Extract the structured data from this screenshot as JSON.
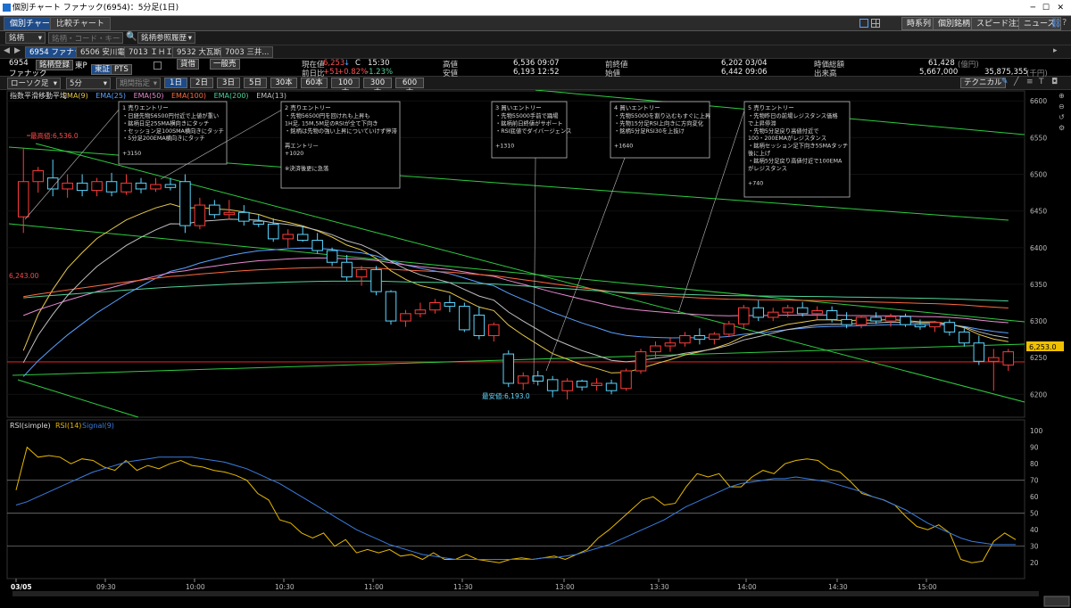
{
  "window": {
    "title": "個別チャート ファナック(6954)：5分足(1日)"
  },
  "tabs": [
    {
      "label": "個別チャート"
    },
    {
      "label": "比較チャート"
    }
  ],
  "top_buttons": [
    "時系列",
    "個別銘柄",
    "スピード注文",
    "ニュース"
  ],
  "symbol_bar": {
    "type": "銘柄",
    "search_placeholder": "銘柄・コード・キーワード",
    "history": "銘柄参照履歴"
  },
  "symbol_tabs": [
    "6954 ファナック",
    "6506 安川電",
    "7013 ＩＨＩ",
    "9532 大瓦斯",
    "7003 三井..."
  ],
  "quote": {
    "code": "6954",
    "name": "ファナック",
    "register": "銘柄登録",
    "market": "東P",
    "exch_tse": "東証",
    "exch_pts": "PTS",
    "order_type": "貸借",
    "margin": "一般売",
    "current_label": "現在値",
    "current": "6,253",
    "arrow": "↓",
    "c": "C",
    "time": "15:30",
    "prev_diff_label": "前日比",
    "diff": "+51",
    "diff_pct": "+0.82%",
    "diff_pct2": "-1.23%",
    "high_label": "高値",
    "high": "6,536 09:07",
    "low_label": "安値",
    "low": "6,193 12:52",
    "prev_close_label": "前終値",
    "prev_close": "6,202 03/04",
    "open_label": "始値",
    "open": "6,442 09:06",
    "mcap_label": "時価総額",
    "mcap": "61,428",
    "mcap_unit": "(億円)",
    "volume_label": "出来高",
    "volume": "5,667,000",
    "turnover": "35,875,355",
    "turnover_unit": "(千円)"
  },
  "controls": {
    "chart_type": "ローソク足",
    "interval": "5分",
    "period": "期間指定",
    "ranges": [
      "1日",
      "2日",
      "3日",
      "5日",
      "30本",
      "60本",
      "100本",
      "300本",
      "600本"
    ],
    "technical": "テクニカル"
  },
  "legend": {
    "title": "指数平滑移動平均",
    "items": [
      {
        "label": "EMA(9)",
        "color": "#e6c84a"
      },
      {
        "label": "EMA(25)",
        "color": "#5aa0ff"
      },
      {
        "label": "EMA(50)",
        "color": "#e68ad0"
      },
      {
        "label": "EMA(100)",
        "color": "#ff6a3d"
      },
      {
        "label": "EMA(200)",
        "color": "#4fd29a"
      },
      {
        "label": "EMA(13)",
        "color": "#c0c0c0"
      }
    ]
  },
  "annotations": [
    {
      "title": "1 売りエントリー",
      "lines": [
        "・日経先物56500円付近で上値が重い",
        "・銘柄日足25SMA横向きにタッチ",
        "・セッション足100SMA横向きにタッチ",
        "・5分足200EMA横向きにタッチ",
        "",
        "+3150"
      ]
    },
    {
      "title": "2 売りエントリー",
      "lines": [
        "・先物56500円を回けれも上昇も",
        "1H足, 15M,5M足のRSIが全て下向き",
        "・銘柄は先物の強い上昇についていけず停滞",
        "",
        "再エントリー",
        "+1020",
        "",
        "※決済後更に急落"
      ]
    },
    {
      "title": "3 買いエントリー",
      "lines": [
        "・先物55000手前で踊場",
        "・銘柄前日終値がサポート",
        "・RSI底値でダイバージェンス",
        "",
        "+1310"
      ]
    },
    {
      "title": "4 買いエントリー",
      "lines": [
        "・先物55000を割り込むもすぐに上昇",
        "・先物15分足RSI上向きに方向変化",
        "・銘柄5分足RSI30を上抜け",
        "",
        "+1640"
      ]
    },
    {
      "title": "5 売りエントリー",
      "lines": [
        "・先物昨日の前場レジスタンス価格",
        "で上昇停滞",
        "・先物5分足戻り高値付近で",
        "100・200EMAがレジスタンス",
        "・銘柄セッション足下向き5SMAタッチ",
        "後に上げ",
        "・銘柄5分足戻り高値付近で100EMA",
        "がレジスタンス",
        "",
        "+740"
      ]
    }
  ],
  "markers": {
    "high_label": "最高値:6,536.0",
    "low_label": "最安値:6,193.0",
    "level_label": "6,243.00",
    "last_price": "6,253.0"
  },
  "chart_data": [
    {
      "type": "candlestick",
      "title": "指数平滑移動平均",
      "ylim": [
        6170,
        6610
      ],
      "yticks": [
        6200,
        6250,
        6300,
        6350,
        6400,
        6450,
        6500,
        6550,
        6600
      ],
      "xticks": [
        "03/05",
        "09:30",
        "10:00",
        "10:30",
        "11:00",
        "11:30",
        "13:00",
        "13:30",
        "14:00",
        "14:30",
        "15:00"
      ],
      "candles": [
        {
          "t": "09:00",
          "o": 6442,
          "h": 6536,
          "l": 6420,
          "c": 6490
        },
        {
          "t": "09:05",
          "o": 6490,
          "h": 6510,
          "l": 6475,
          "c": 6505
        },
        {
          "t": "09:10",
          "o": 6495,
          "h": 6520,
          "l": 6470,
          "c": 6480
        },
        {
          "t": "09:15",
          "o": 6480,
          "h": 6500,
          "l": 6468,
          "c": 6488
        },
        {
          "t": "09:20",
          "o": 6488,
          "h": 6500,
          "l": 6470,
          "c": 6478
        },
        {
          "t": "09:25",
          "o": 6478,
          "h": 6495,
          "l": 6470,
          "c": 6490
        },
        {
          "t": "09:30",
          "o": 6490,
          "h": 6502,
          "l": 6470,
          "c": 6476
        },
        {
          "t": "09:35",
          "o": 6476,
          "h": 6500,
          "l": 6472,
          "c": 6488
        },
        {
          "t": "09:40",
          "o": 6488,
          "h": 6495,
          "l": 6474,
          "c": 6480
        },
        {
          "t": "09:45",
          "o": 6480,
          "h": 6495,
          "l": 6476,
          "c": 6486
        },
        {
          "t": "09:50",
          "o": 6486,
          "h": 6495,
          "l": 6478,
          "c": 6482
        },
        {
          "t": "09:55",
          "o": 6490,
          "h": 6500,
          "l": 6420,
          "c": 6430
        },
        {
          "t": "10:00",
          "o": 6430,
          "h": 6468,
          "l": 6425,
          "c": 6458
        },
        {
          "t": "10:05",
          "o": 6458,
          "h": 6465,
          "l": 6440,
          "c": 6445
        },
        {
          "t": "10:10",
          "o": 6445,
          "h": 6465,
          "l": 6438,
          "c": 6448
        },
        {
          "t": "10:15",
          "o": 6448,
          "h": 6458,
          "l": 6430,
          "c": 6436
        },
        {
          "t": "10:20",
          "o": 6436,
          "h": 6445,
          "l": 6428,
          "c": 6432
        },
        {
          "t": "10:25",
          "o": 6432,
          "h": 6440,
          "l": 6408,
          "c": 6412
        },
        {
          "t": "10:30",
          "o": 6412,
          "h": 6425,
          "l": 6400,
          "c": 6418
        },
        {
          "t": "10:35",
          "o": 6418,
          "h": 6430,
          "l": 6408,
          "c": 6410
        },
        {
          "t": "10:40",
          "o": 6410,
          "h": 6420,
          "l": 6392,
          "c": 6396
        },
        {
          "t": "10:45",
          "o": 6396,
          "h": 6400,
          "l": 6375,
          "c": 6380
        },
        {
          "t": "10:50",
          "o": 6380,
          "h": 6390,
          "l": 6355,
          "c": 6360
        },
        {
          "t": "10:55",
          "o": 6360,
          "h": 6375,
          "l": 6348,
          "c": 6370
        },
        {
          "t": "11:00",
          "o": 6370,
          "h": 6375,
          "l": 6335,
          "c": 6340
        },
        {
          "t": "11:05",
          "o": 6340,
          "h": 6342,
          "l": 6295,
          "c": 6300
        },
        {
          "t": "11:10",
          "o": 6300,
          "h": 6315,
          "l": 6292,
          "c": 6310
        },
        {
          "t": "11:15",
          "o": 6310,
          "h": 6325,
          "l": 6305,
          "c": 6315
        },
        {
          "t": "11:20",
          "o": 6315,
          "h": 6330,
          "l": 6310,
          "c": 6325
        },
        {
          "t": "11:25",
          "o": 6325,
          "h": 6335,
          "l": 6312,
          "c": 6320
        },
        {
          "t": "11:30",
          "o": 6320,
          "h": 6325,
          "l": 6285,
          "c": 6288
        },
        {
          "t": "12:30",
          "o": 6308,
          "h": 6320,
          "l": 6275,
          "c": 6280
        },
        {
          "t": "12:35",
          "o": 6280,
          "h": 6298,
          "l": 6272,
          "c": 6295
        },
        {
          "t": "12:40",
          "o": 6255,
          "h": 6260,
          "l": 6210,
          "c": 6215
        },
        {
          "t": "12:45",
          "o": 6215,
          "h": 6230,
          "l": 6206,
          "c": 6225
        },
        {
          "t": "12:50",
          "o": 6225,
          "h": 6232,
          "l": 6212,
          "c": 6218
        },
        {
          "t": "12:55",
          "o": 6220,
          "h": 6225,
          "l": 6196,
          "c": 6205
        },
        {
          "t": "13:00",
          "o": 6205,
          "h": 6222,
          "l": 6193,
          "c": 6218
        },
        {
          "t": "13:05",
          "o": 6218,
          "h": 6220,
          "l": 6205,
          "c": 6210
        },
        {
          "t": "13:10",
          "o": 6212,
          "h": 6222,
          "l": 6205,
          "c": 6215
        },
        {
          "t": "13:15",
          "o": 6215,
          "h": 6220,
          "l": 6200,
          "c": 6205
        },
        {
          "t": "13:20",
          "o": 6208,
          "h": 6235,
          "l": 6205,
          "c": 6232
        },
        {
          "t": "13:25",
          "o": 6232,
          "h": 6262,
          "l": 6228,
          "c": 6258
        },
        {
          "t": "13:30",
          "o": 6258,
          "h": 6272,
          "l": 6250,
          "c": 6266
        },
        {
          "t": "13:35",
          "o": 6266,
          "h": 6278,
          "l": 6258,
          "c": 6270
        },
        {
          "t": "13:40",
          "o": 6270,
          "h": 6285,
          "l": 6265,
          "c": 6280
        },
        {
          "t": "13:45",
          "o": 6280,
          "h": 6290,
          "l": 6268,
          "c": 6275
        },
        {
          "t": "13:50",
          "o": 6275,
          "h": 6285,
          "l": 6268,
          "c": 6282
        },
        {
          "t": "13:55",
          "o": 6282,
          "h": 6300,
          "l": 6278,
          "c": 6296
        },
        {
          "t": "14:00",
          "o": 6296,
          "h": 6322,
          "l": 6290,
          "c": 6318
        },
        {
          "t": "14:05",
          "o": 6318,
          "h": 6328,
          "l": 6300,
          "c": 6305
        },
        {
          "t": "14:10",
          "o": 6305,
          "h": 6318,
          "l": 6300,
          "c": 6312
        },
        {
          "t": "14:15",
          "o": 6312,
          "h": 6322,
          "l": 6305,
          "c": 6318
        },
        {
          "t": "14:20",
          "o": 6318,
          "h": 6326,
          "l": 6306,
          "c": 6310
        },
        {
          "t": "14:25",
          "o": 6310,
          "h": 6320,
          "l": 6302,
          "c": 6314
        },
        {
          "t": "14:30",
          "o": 6314,
          "h": 6320,
          "l": 6298,
          "c": 6302
        },
        {
          "t": "14:35",
          "o": 6302,
          "h": 6312,
          "l": 6290,
          "c": 6295
        },
        {
          "t": "14:40",
          "o": 6295,
          "h": 6308,
          "l": 6290,
          "c": 6305
        },
        {
          "t": "14:45",
          "o": 6305,
          "h": 6312,
          "l": 6296,
          "c": 6300
        },
        {
          "t": "14:50",
          "o": 6300,
          "h": 6310,
          "l": 6292,
          "c": 6306
        },
        {
          "t": "14:55",
          "o": 6306,
          "h": 6310,
          "l": 6292,
          "c": 6295
        },
        {
          "t": "15:00",
          "o": 6295,
          "h": 6302,
          "l": 6288,
          "c": 6292
        },
        {
          "t": "15:05",
          "o": 6292,
          "h": 6300,
          "l": 6285,
          "c": 6298
        },
        {
          "t": "15:10",
          "o": 6298,
          "h": 6302,
          "l": 6280,
          "c": 6285
        },
        {
          "t": "15:15",
          "o": 6285,
          "h": 6290,
          "l": 6265,
          "c": 6270
        },
        {
          "t": "15:20",
          "o": 6270,
          "h": 6280,
          "l": 6240,
          "c": 6245
        },
        {
          "t": "15:25",
          "o": 6245,
          "h": 6262,
          "l": 6205,
          "c": 6250
        },
        {
          "t": "15:30",
          "o": 6240,
          "h": 6262,
          "l": 6232,
          "c": 6258
        }
      ]
    },
    {
      "type": "line",
      "title": "RSI(simple)",
      "ylim": [
        12,
        105
      ],
      "yticks": [
        20,
        30,
        40,
        50,
        60,
        70,
        80,
        90,
        100
      ],
      "hlines": [
        30,
        50,
        70
      ],
      "series": [
        {
          "name": "RSI(14)",
          "color": "#e6b800",
          "values": [
            64,
            90,
            84,
            85,
            84,
            80,
            83,
            82,
            78,
            76,
            82,
            76,
            79,
            77,
            80,
            82,
            79,
            78,
            76,
            75,
            73,
            70,
            62,
            58,
            46,
            44,
            38,
            35,
            38,
            30,
            34,
            26,
            28,
            26,
            28,
            24,
            25,
            22,
            26,
            22,
            22,
            25,
            22,
            21,
            20,
            22,
            23,
            22,
            23,
            24,
            22,
            25,
            28,
            35,
            40,
            46,
            52,
            58,
            60,
            55,
            56,
            66,
            74,
            72,
            74,
            66,
            66,
            72,
            76,
            74,
            80,
            82,
            83,
            82,
            77,
            75,
            69,
            62,
            60,
            58,
            55,
            48,
            42,
            40,
            43,
            38,
            22,
            20,
            21,
            33,
            38,
            34
          ]
        },
        {
          "name": "Signal(9)",
          "color": "#3a7de0",
          "values": [
            55,
            57,
            60,
            63,
            66,
            69,
            72,
            75,
            77,
            79,
            81,
            82,
            83,
            84,
            84,
            84,
            84,
            83,
            82,
            81,
            79,
            77,
            74,
            71,
            68,
            64,
            60,
            56,
            52,
            48,
            44,
            40,
            37,
            34,
            31,
            29,
            27,
            25,
            24,
            23,
            22,
            22,
            22,
            22,
            22,
            22,
            22,
            22,
            23,
            23,
            24,
            25,
            27,
            29,
            31,
            34,
            37,
            40,
            43,
            46,
            50,
            54,
            57,
            60,
            63,
            66,
            68,
            69,
            70,
            71,
            71,
            72,
            71,
            70,
            69,
            67,
            65,
            63,
            60,
            58,
            55,
            52,
            48,
            44,
            41,
            38,
            35,
            33,
            32,
            31,
            31,
            31
          ]
        }
      ]
    }
  ]
}
